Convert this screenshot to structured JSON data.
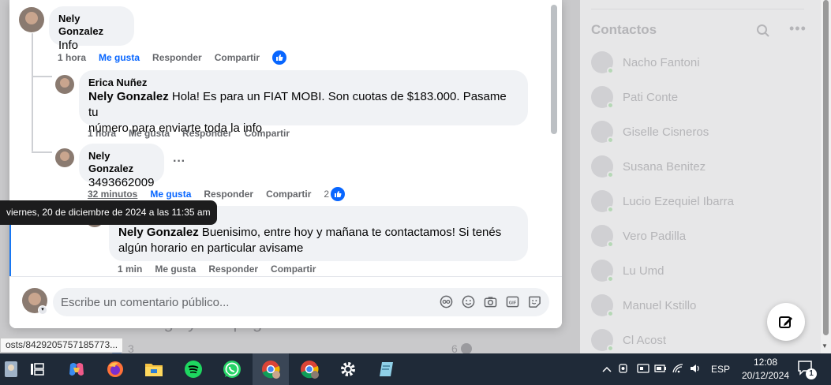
{
  "background": {
    "post_text": "se entrega y vas pagando",
    "likes_count": "3",
    "comments_count": "6",
    "url_tooltip": "osts/8429205757185773...",
    "contacts_title": "Contactos",
    "contacts": [
      "Nacho Fantoni",
      "Pati Conte",
      "Giselle Cisneros",
      "Susana Benitez",
      "Lucio Ezequiel Ibarra",
      "Vero Padilla",
      "Lu Umd",
      "Manuel Kstillo",
      "Cl Acost"
    ]
  },
  "thread": {
    "c1": {
      "author": "Nely Gonzalez",
      "text": "Info",
      "time": "1 hora",
      "like": "Me gusta",
      "reply": "Responder",
      "share": "Compartir"
    },
    "c2": {
      "author": "Erica Nuñez",
      "mention": "Nely Gonzalez",
      "text_line1": " Hola! Es para un FIAT MOBI. Son cuotas de $183.000. Pasame tu",
      "text_line2": "número para enviarte toda la info",
      "time": "1 hora",
      "like": "Me gusta",
      "reply": "Responder",
      "share": "Compartir"
    },
    "c3": {
      "author": "Nely Gonzalez",
      "text": "3493662009",
      "time": "32 minutos",
      "like": "Me gusta",
      "reply": "Responder",
      "share": "Compartir",
      "reactions": "2"
    },
    "c4": {
      "author": "Erica Nuñez",
      "mention": "Nely Gonzalez",
      "text_line1": " Buenisimo, entre hoy y mañana te contactamos! Si tenés",
      "text_line2": "algún horario en particular avisame",
      "time": "1 min",
      "like": "Me gusta",
      "reply": "Responder",
      "share": "Compartir"
    }
  },
  "tooltip": "viernes, 20 de diciembre de 2024 a las 11:35 am",
  "comment_input": {
    "placeholder": "Escribe un comentario público..."
  },
  "taskbar": {
    "language": "ESP",
    "time": "12:08",
    "date": "20/12/2024",
    "notifications": "1"
  },
  "colors": {
    "accent": "#0866ff",
    "bubble": "#f0f2f5",
    "taskbar": "#1f2a38"
  }
}
